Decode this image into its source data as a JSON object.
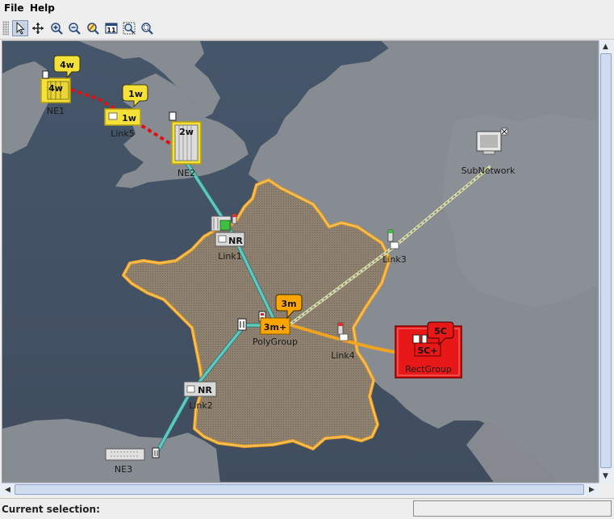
{
  "menu": {
    "file": "File",
    "help": "Help"
  },
  "toolbar": {
    "buttons": [
      {
        "name": "select-tool-button",
        "icon": "arrow-pointer-icon",
        "selected": true
      },
      {
        "name": "pan-tool-button",
        "icon": "move-arrows-icon"
      },
      {
        "name": "zoom-in-button",
        "icon": "zoom-in-icon"
      },
      {
        "name": "zoom-out-button",
        "icon": "zoom-out-icon"
      },
      {
        "name": "zoom-reset-button",
        "icon": "zoom-pencil-icon"
      },
      {
        "name": "zoom-one-to-one-button",
        "icon": "one-to-one-icon",
        "text": "11"
      },
      {
        "name": "fit-to-view-button",
        "icon": "zoom-fit-icon"
      },
      {
        "name": "zoom-rect-button",
        "icon": "zoom-rect-icon"
      }
    ]
  },
  "nodes": {
    "ne1": {
      "label": "NE1",
      "badge": "4w",
      "alarm": "4w"
    },
    "link5": {
      "label": "Link5",
      "badge": "1w",
      "alarm": "1w"
    },
    "ne2": {
      "label": "NE2",
      "alarm": "2w"
    },
    "subnetwork": {
      "label": "SubNetwork"
    },
    "link1": {
      "label": "Link1",
      "alarm": "NR"
    },
    "link3": {
      "label": "Link3"
    },
    "polygroup": {
      "label": "PolyGroup",
      "badge": "3m",
      "alarm": "3m+"
    },
    "link4": {
      "label": "Link4"
    },
    "rectgroup": {
      "label": "RectGroup",
      "badge": "5C",
      "alarm": "5C+"
    },
    "link2": {
      "label": "Link2",
      "alarm": "NR"
    },
    "ne3": {
      "label": "NE3"
    }
  },
  "colors": {
    "sea": "#4f5c6a",
    "land": "#8a8f95",
    "france_fill": "#8b7d6b",
    "france_border": "#f0a320",
    "link_cyan": "#5ec8c0",
    "link_orange": "#f0a320",
    "link_red": "#e01010",
    "warning_yellow": "#f5e13a",
    "critical_red": "#e81818",
    "major_orange": "#ffa500"
  },
  "status": {
    "label": "Current selection:",
    "value": ""
  }
}
